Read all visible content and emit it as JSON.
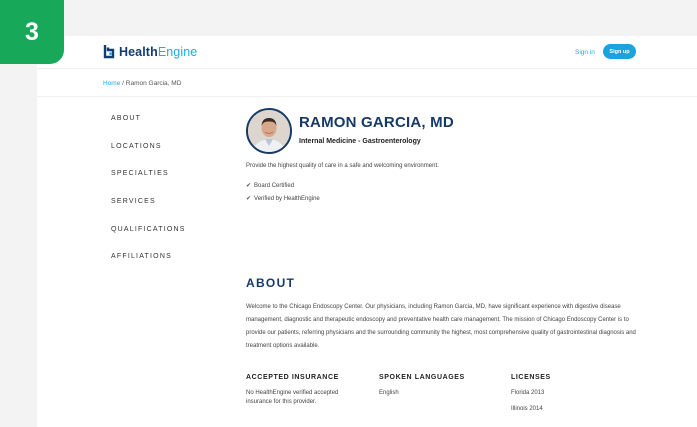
{
  "step": {
    "number": "3"
  },
  "header": {
    "logo_part1": "Health",
    "logo_part2": "Engine",
    "sign_in": "Sign in",
    "sign_up": "Sign up"
  },
  "breadcrumb": {
    "home": "Home",
    "separator": " / ",
    "current": "Ramon Garcia, MD"
  },
  "sidenav": {
    "items": [
      "ABOUT",
      "LOCATIONS",
      "SPECIALTIES",
      "SERVICES",
      "QUALIFICATIONS",
      "AFFILIATIONS"
    ]
  },
  "profile": {
    "name": "RAMON GARCIA, MD",
    "specialty": "Internal Medicine - Gastroenterology",
    "tagline": "Provide the highest quality of care in a safe and welcoming environment.",
    "features": [
      "Board Certified",
      "Verified by HealthEngine"
    ]
  },
  "about": {
    "title": "ABOUT",
    "text": "Welcome to the Chicago Endoscopy Center. Our physicians, including Ramon Garcia, MD, have significant experience with digestive disease management, diagnostic and therapeutic endoscopy and preventative health care management. The mission of Chicago Endoscopy Center is to provide our patients, referring physicians and the surrounding community the highest, most comprehensive quality of gastrointestinal diagnosis and treatment options available."
  },
  "insurance": {
    "title": "ACCEPTED INSURANCE",
    "text": "No HealthEngine verified accepted insurance for this provider."
  },
  "languages": {
    "title": "SPOKEN LANGUAGES",
    "text": "English"
  },
  "licenses": {
    "title": "LICENSES",
    "items": [
      "Florida 2013",
      "Illinois 2014"
    ]
  },
  "colors": {
    "navy": "#173a66",
    "brand_blue": "#1dabe3",
    "step_green": "#17a85a"
  }
}
